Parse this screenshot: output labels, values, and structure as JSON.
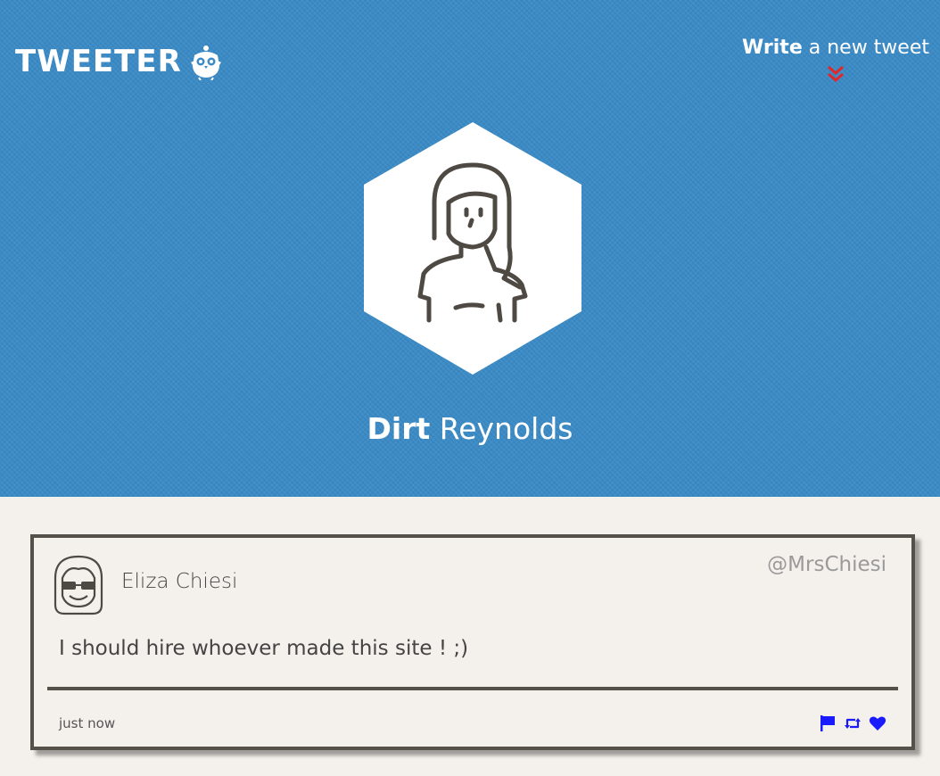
{
  "header": {
    "logo_text": "TWEETER",
    "logo_icon": "owl-icon",
    "compose": {
      "bold": "Write",
      "rest": " a new tweet",
      "icon": "double-chevron-down-icon",
      "icon_color": "#e0272a"
    },
    "background_color": "#398ac6"
  },
  "profile": {
    "first_name": "Dirt",
    "last_name": " Reynolds",
    "avatar_icon": "woman-avatar-icon"
  },
  "tweet": {
    "author": "Eliza Chiesi",
    "handle": "@MrsChiesi",
    "text": "I should hire whoever made this site ! ;)",
    "timestamp": "just now",
    "avatar_icon": "avatar-glasses-icon",
    "actions": [
      {
        "name": "flag-icon"
      },
      {
        "name": "retweet-icon"
      },
      {
        "name": "heart-icon"
      }
    ],
    "action_color": "#1a1aff"
  }
}
